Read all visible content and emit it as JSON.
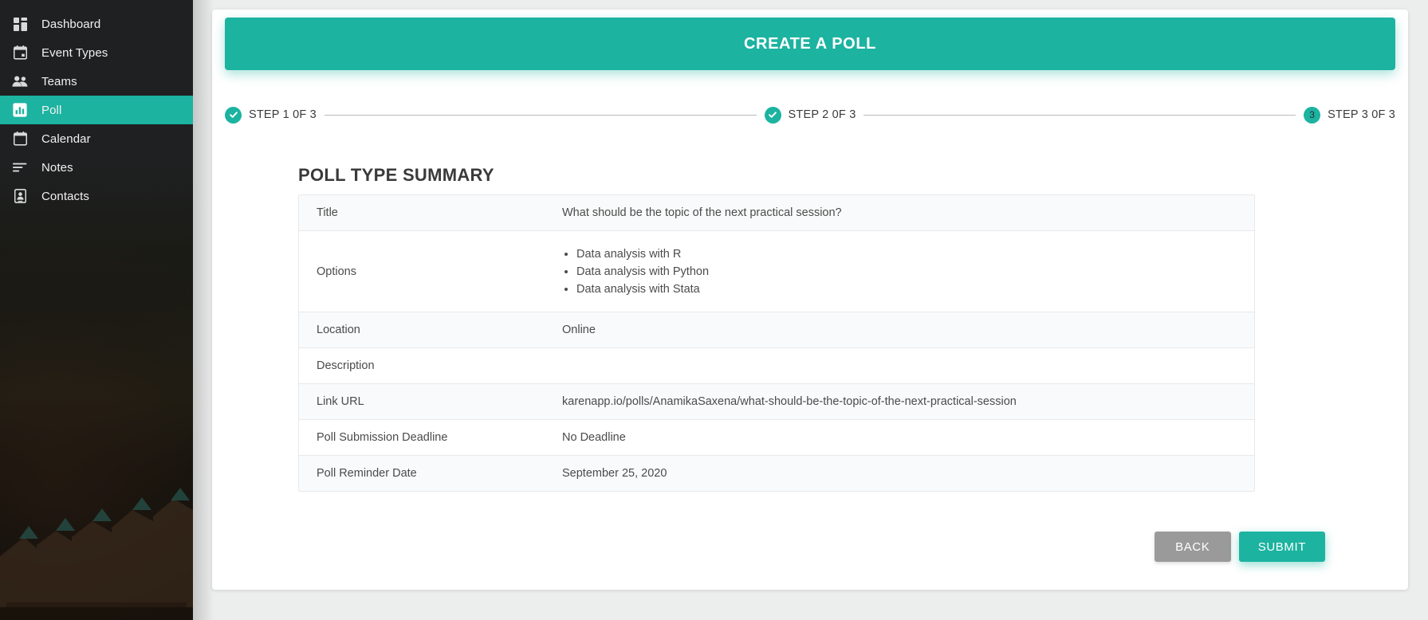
{
  "sidebar": {
    "items": [
      {
        "label": "Dashboard",
        "icon": "dashboard-grid-icon",
        "active": false
      },
      {
        "label": "Event Types",
        "icon": "calendar-event-icon",
        "active": false
      },
      {
        "label": "Teams",
        "icon": "people-icon",
        "active": false
      },
      {
        "label": "Poll",
        "icon": "bar-chart-icon",
        "active": true
      },
      {
        "label": "Calendar",
        "icon": "calendar-icon",
        "active": false
      },
      {
        "label": "Notes",
        "icon": "notes-lines-icon",
        "active": false
      },
      {
        "label": "Contacts",
        "icon": "contact-card-icon",
        "active": false
      }
    ]
  },
  "header": {
    "title": "CREATE A POLL",
    "accent_color": "#1cb3a0"
  },
  "stepper": {
    "steps": [
      {
        "label": "STEP 1 0F 3",
        "state": "complete",
        "marker": "check"
      },
      {
        "label": "STEP 2 0F 3",
        "state": "complete",
        "marker": "check"
      },
      {
        "label": "STEP 3 0F 3",
        "state": "current",
        "marker": "3"
      }
    ]
  },
  "summary": {
    "title": "POLL TYPE SUMMARY",
    "rows": [
      {
        "key": "Title",
        "value": "What should be the topic of the next practical session?",
        "type": "text"
      },
      {
        "key": "Options",
        "type": "list",
        "items": [
          "Data analysis with R",
          "Data analysis with Python",
          "Data analysis with Stata"
        ]
      },
      {
        "key": "Location",
        "value": "Online",
        "type": "text"
      },
      {
        "key": "Description",
        "value": "",
        "type": "text"
      },
      {
        "key": "Link URL",
        "value": "karenapp.io/polls/AnamikaSaxena/what-should-be-the-topic-of-the-next-practical-session",
        "type": "text"
      },
      {
        "key": "Poll Submission Deadline",
        "value": "No Deadline",
        "type": "text"
      },
      {
        "key": "Poll Reminder Date",
        "value": "September 25, 2020",
        "type": "text"
      }
    ]
  },
  "actions": {
    "back_label": "BACK",
    "submit_label": "SUBMIT"
  }
}
